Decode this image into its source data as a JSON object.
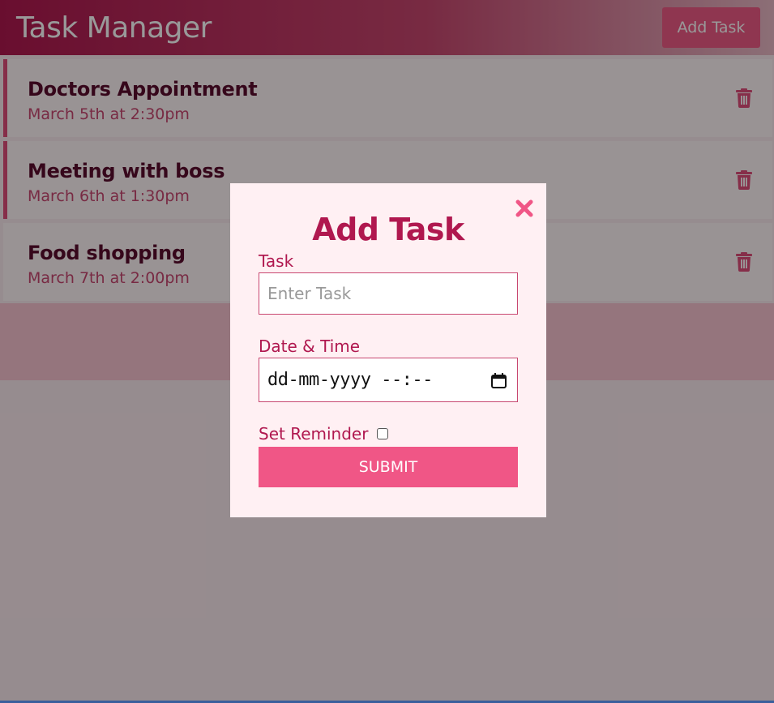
{
  "header": {
    "title": "Task Manager",
    "add_button_label": "Add Task"
  },
  "tasks": [
    {
      "title": "Doctors Appointment",
      "date": "March 5th at 2:30pm",
      "reminder": true
    },
    {
      "title": "Meeting with boss",
      "date": "March 6th at 1:30pm",
      "reminder": true
    },
    {
      "title": "Food shopping",
      "date": "March 7th at 2:00pm",
      "reminder": false
    }
  ],
  "modal": {
    "title": "Add Task",
    "task_label": "Task",
    "task_placeholder": "Enter Task",
    "task_value": "",
    "datetime_label": "Date & Time",
    "datetime_value": "dd-mm-yyyy --:--",
    "reminder_label": "Set Reminder",
    "reminder_checked": false,
    "submit_label": "SUBMIT"
  },
  "icons": {
    "delete": "trash-icon",
    "close": "close-icon",
    "calendar": "calendar-icon"
  },
  "colors": {
    "primary": "#b0184f",
    "accent": "#f05686",
    "modal_background": "#fff0f3"
  }
}
